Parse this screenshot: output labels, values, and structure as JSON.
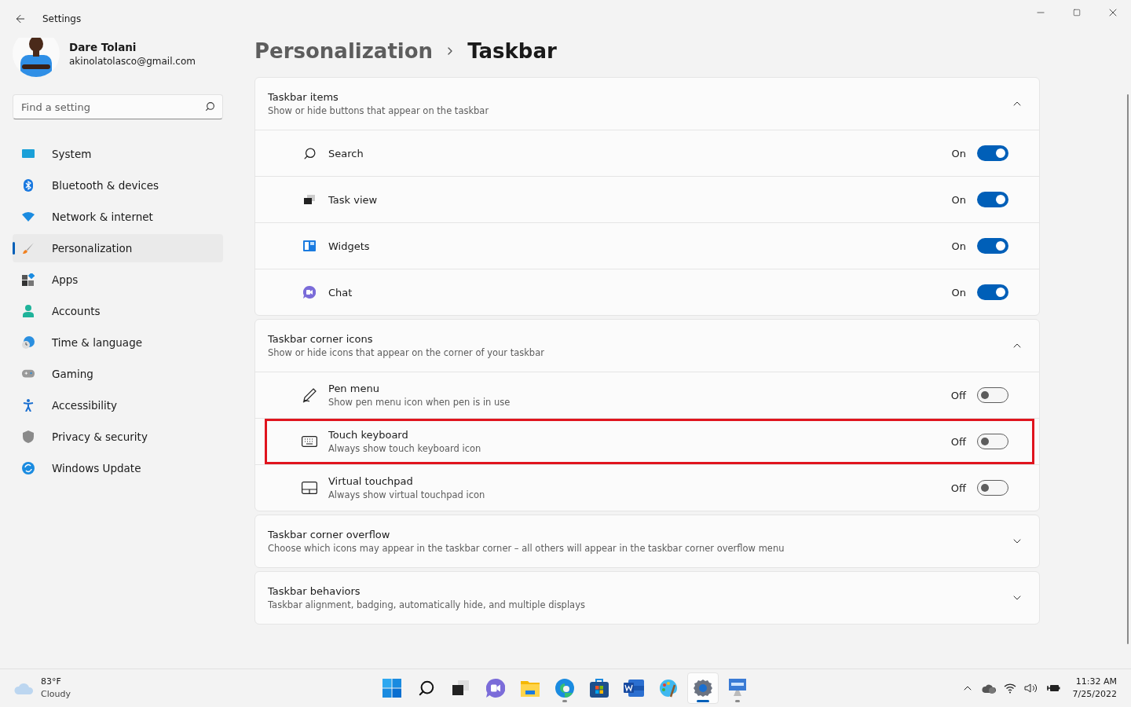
{
  "window": {
    "title": "Settings"
  },
  "user": {
    "name": "Dare Tolani",
    "email": "akinolatolasco@gmail.com"
  },
  "search": {
    "placeholder": "Find a setting"
  },
  "nav": [
    {
      "label": "System",
      "selected": false
    },
    {
      "label": "Bluetooth & devices",
      "selected": false
    },
    {
      "label": "Network & internet",
      "selected": false
    },
    {
      "label": "Personalization",
      "selected": true
    },
    {
      "label": "Apps",
      "selected": false
    },
    {
      "label": "Accounts",
      "selected": false
    },
    {
      "label": "Time & language",
      "selected": false
    },
    {
      "label": "Gaming",
      "selected": false
    },
    {
      "label": "Accessibility",
      "selected": false
    },
    {
      "label": "Privacy & security",
      "selected": false
    },
    {
      "label": "Windows Update",
      "selected": false
    }
  ],
  "breadcrumb": {
    "parent": "Personalization",
    "current": "Taskbar"
  },
  "sections": [
    {
      "title": "Taskbar items",
      "subtitle": "Show or hide buttons that appear on the taskbar",
      "expanded": true,
      "items": [
        {
          "kind": "search",
          "label": "Search",
          "state": "On",
          "on": true,
          "highlighted": false
        },
        {
          "kind": "taskview",
          "label": "Task view",
          "state": "On",
          "on": true,
          "highlighted": false
        },
        {
          "kind": "widgets",
          "label": "Widgets",
          "state": "On",
          "on": true,
          "highlighted": false
        },
        {
          "kind": "chat",
          "label": "Chat",
          "state": "On",
          "on": true,
          "highlighted": false
        }
      ]
    },
    {
      "title": "Taskbar corner icons",
      "subtitle": "Show or hide icons that appear on the corner of your taskbar",
      "expanded": true,
      "items": [
        {
          "kind": "pen",
          "label": "Pen menu",
          "description": "Show pen menu icon when pen is in use",
          "state": "Off",
          "on": false,
          "highlighted": false
        },
        {
          "kind": "keyboard",
          "label": "Touch keyboard",
          "description": "Always show touch keyboard icon",
          "state": "Off",
          "on": false,
          "highlighted": true
        },
        {
          "kind": "touchpad",
          "label": "Virtual touchpad",
          "description": "Always show virtual touchpad icon",
          "state": "Off",
          "on": false,
          "highlighted": false
        }
      ]
    },
    {
      "title": "Taskbar corner overflow",
      "subtitle": "Choose which icons may appear in the taskbar corner – all others will appear in the taskbar corner overflow menu",
      "expanded": false
    },
    {
      "title": "Taskbar behaviors",
      "subtitle": "Taskbar alignment, badging, automatically hide, and multiple displays",
      "expanded": false
    }
  ],
  "taskbar": {
    "weather": {
      "temperature": "83°F",
      "condition": "Cloudy"
    },
    "apps": [
      {
        "kind": "start",
        "running": false,
        "selected": false
      },
      {
        "kind": "search",
        "running": false,
        "selected": false
      },
      {
        "kind": "taskview",
        "running": false,
        "selected": false
      },
      {
        "kind": "chat",
        "running": false,
        "selected": false
      },
      {
        "kind": "folder",
        "running": false,
        "selected": false
      },
      {
        "kind": "browser",
        "running": true,
        "selected": false
      },
      {
        "kind": "store",
        "running": false,
        "selected": false
      },
      {
        "kind": "word",
        "running": false,
        "selected": false
      },
      {
        "kind": "paint",
        "running": false,
        "selected": false
      },
      {
        "kind": "settings",
        "running": true,
        "selected": true
      },
      {
        "kind": "remote",
        "running": true,
        "selected": false
      }
    ],
    "clock": {
      "time": "11:32 AM",
      "date": "7/25/2022"
    }
  }
}
